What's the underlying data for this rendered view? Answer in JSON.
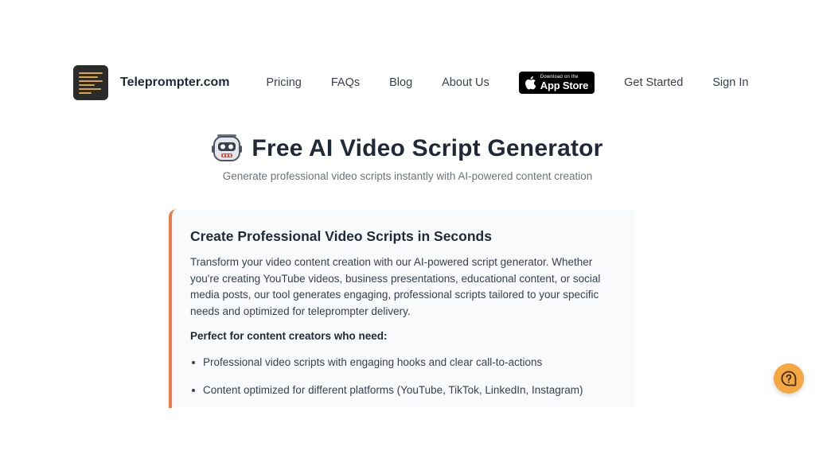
{
  "nav": {
    "brand": "Teleprompter.com",
    "links": [
      "Pricing",
      "FAQs",
      "Blog",
      "About Us"
    ],
    "app_store": {
      "small": "Download on the",
      "big": "App Store"
    },
    "get_started": "Get Started",
    "sign_in": "Sign In"
  },
  "hero": {
    "title": "Free AI Video Script Generator",
    "subtitle": "Generate professional video scripts instantly with AI-powered content creation"
  },
  "card": {
    "heading": "Create Professional Video Scripts in Seconds",
    "body": "Transform your video content creation with our AI-powered script generator. Whether you're creating YouTube videos, business presentations, educational content, or social media posts, our tool generates engaging, professional scripts tailored to your specific needs and optimized for teleprompter delivery.",
    "perfect_label": "Perfect for content creators who need:",
    "bullets": [
      "Professional video scripts with engaging hooks and clear call-to-actions",
      "Content optimized for different platforms (YouTube, TikTok, LinkedIn, Instagram)"
    ]
  },
  "help_button": {
    "icon": "help-question-icon"
  },
  "colors": {
    "accent": "#ef7b45",
    "help": "#f5a742",
    "card_bg": "#f8fafc"
  }
}
